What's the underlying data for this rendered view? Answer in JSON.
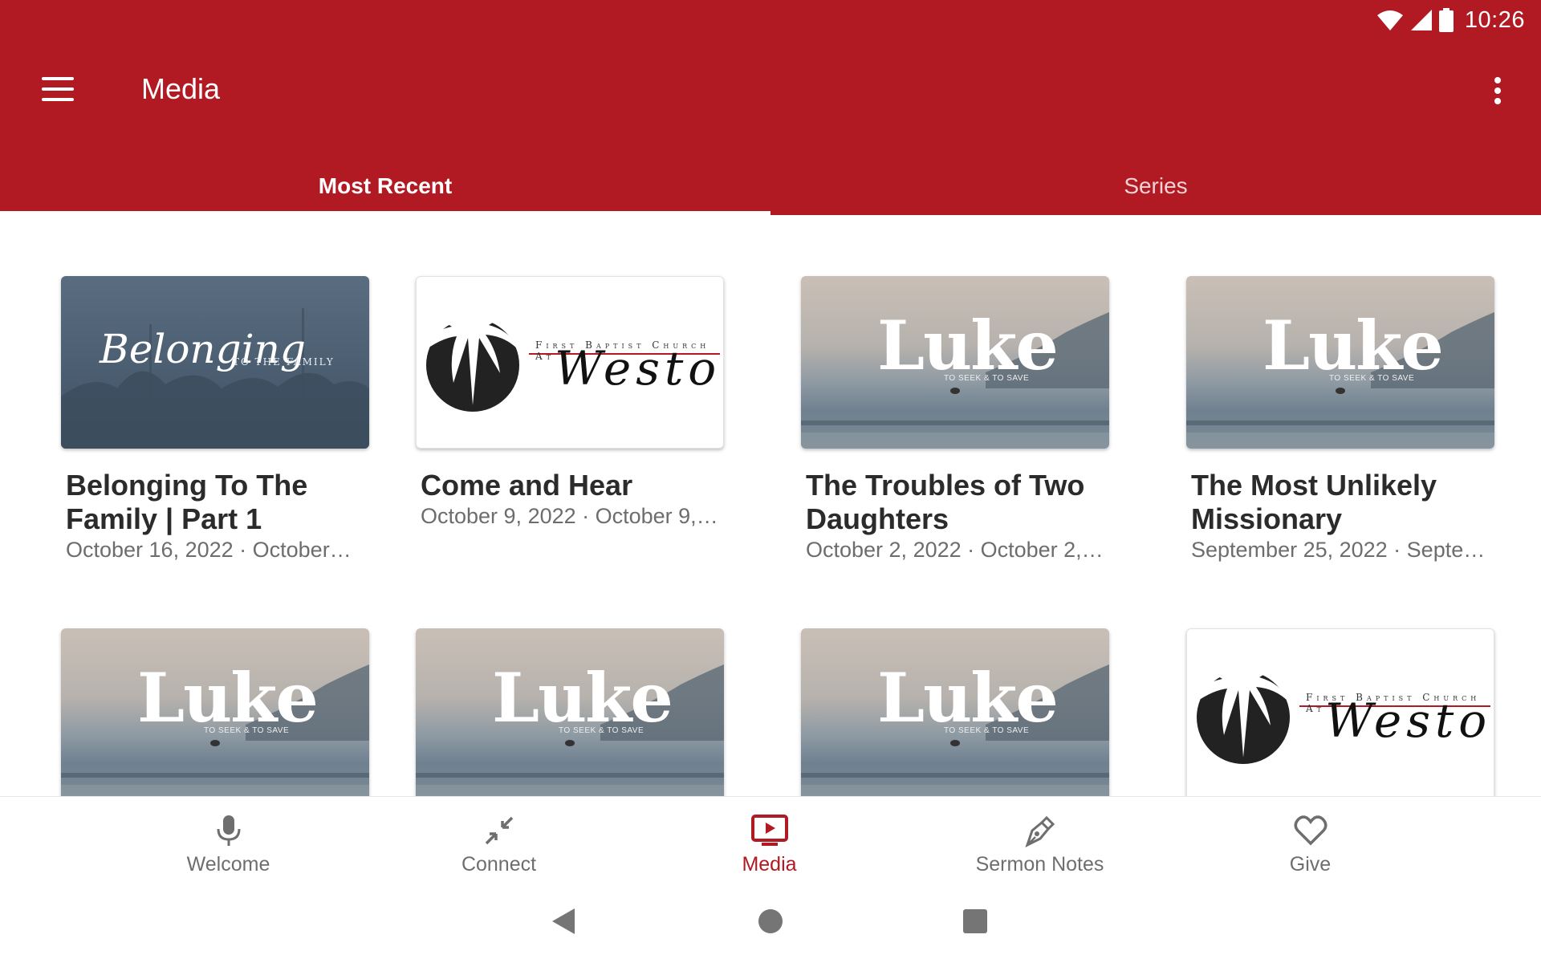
{
  "status_bar": {
    "time": "10:26"
  },
  "header": {
    "title": "Media"
  },
  "tabs": [
    {
      "label": "Most Recent",
      "active": true
    },
    {
      "label": "Series",
      "active": false
    }
  ],
  "cards": [
    {
      "thumb": "belonging",
      "thumb_text": "Belonging",
      "thumb_sub": "TO THE FAMILY",
      "title": "Belonging To The Family | Part 1",
      "date": "October 16, 2022 · October…"
    },
    {
      "thumb": "weston",
      "thumb_text": "Weston",
      "thumb_sub": "First Baptist Church At",
      "title": "Come and Hear",
      "date": "October 9, 2022 · October 9,…"
    },
    {
      "thumb": "luke",
      "thumb_text": "Luke",
      "thumb_sub": "TO SEEK & TO SAVE",
      "title": "The Troubles of Two Daughters",
      "date": "October 2, 2022 · October 2,…"
    },
    {
      "thumb": "luke",
      "thumb_text": "Luke",
      "thumb_sub": "TO SEEK & TO SAVE",
      "title": "The Most Unlikely Missionary",
      "date": "September 25, 2022 · Septe…"
    },
    {
      "thumb": "luke",
      "thumb_text": "Luke",
      "thumb_sub": "TO SEEK & TO SAVE",
      "title": "",
      "date": ""
    },
    {
      "thumb": "luke",
      "thumb_text": "Luke",
      "thumb_sub": "TO SEEK & TO SAVE",
      "title": "",
      "date": ""
    },
    {
      "thumb": "luke",
      "thumb_text": "Luke",
      "thumb_sub": "TO SEEK & TO SAVE",
      "title": "",
      "date": ""
    },
    {
      "thumb": "weston",
      "thumb_text": "Weston",
      "thumb_sub": "First Baptist Church At",
      "title": "",
      "date": ""
    }
  ],
  "bottom_nav": [
    {
      "label": "Welcome",
      "icon": "microphone-icon",
      "active": false
    },
    {
      "label": "Connect",
      "icon": "collapse-arrows-icon",
      "active": false
    },
    {
      "label": "Media",
      "icon": "tv-play-icon",
      "active": true
    },
    {
      "label": "Sermon Notes",
      "icon": "pen-nib-icon",
      "active": false
    },
    {
      "label": "Give",
      "icon": "heart-icon",
      "active": false
    }
  ],
  "colors": {
    "brand": "#b11a22",
    "text_dark": "#2b2b2b",
    "text_muted": "#6d6d6d"
  }
}
